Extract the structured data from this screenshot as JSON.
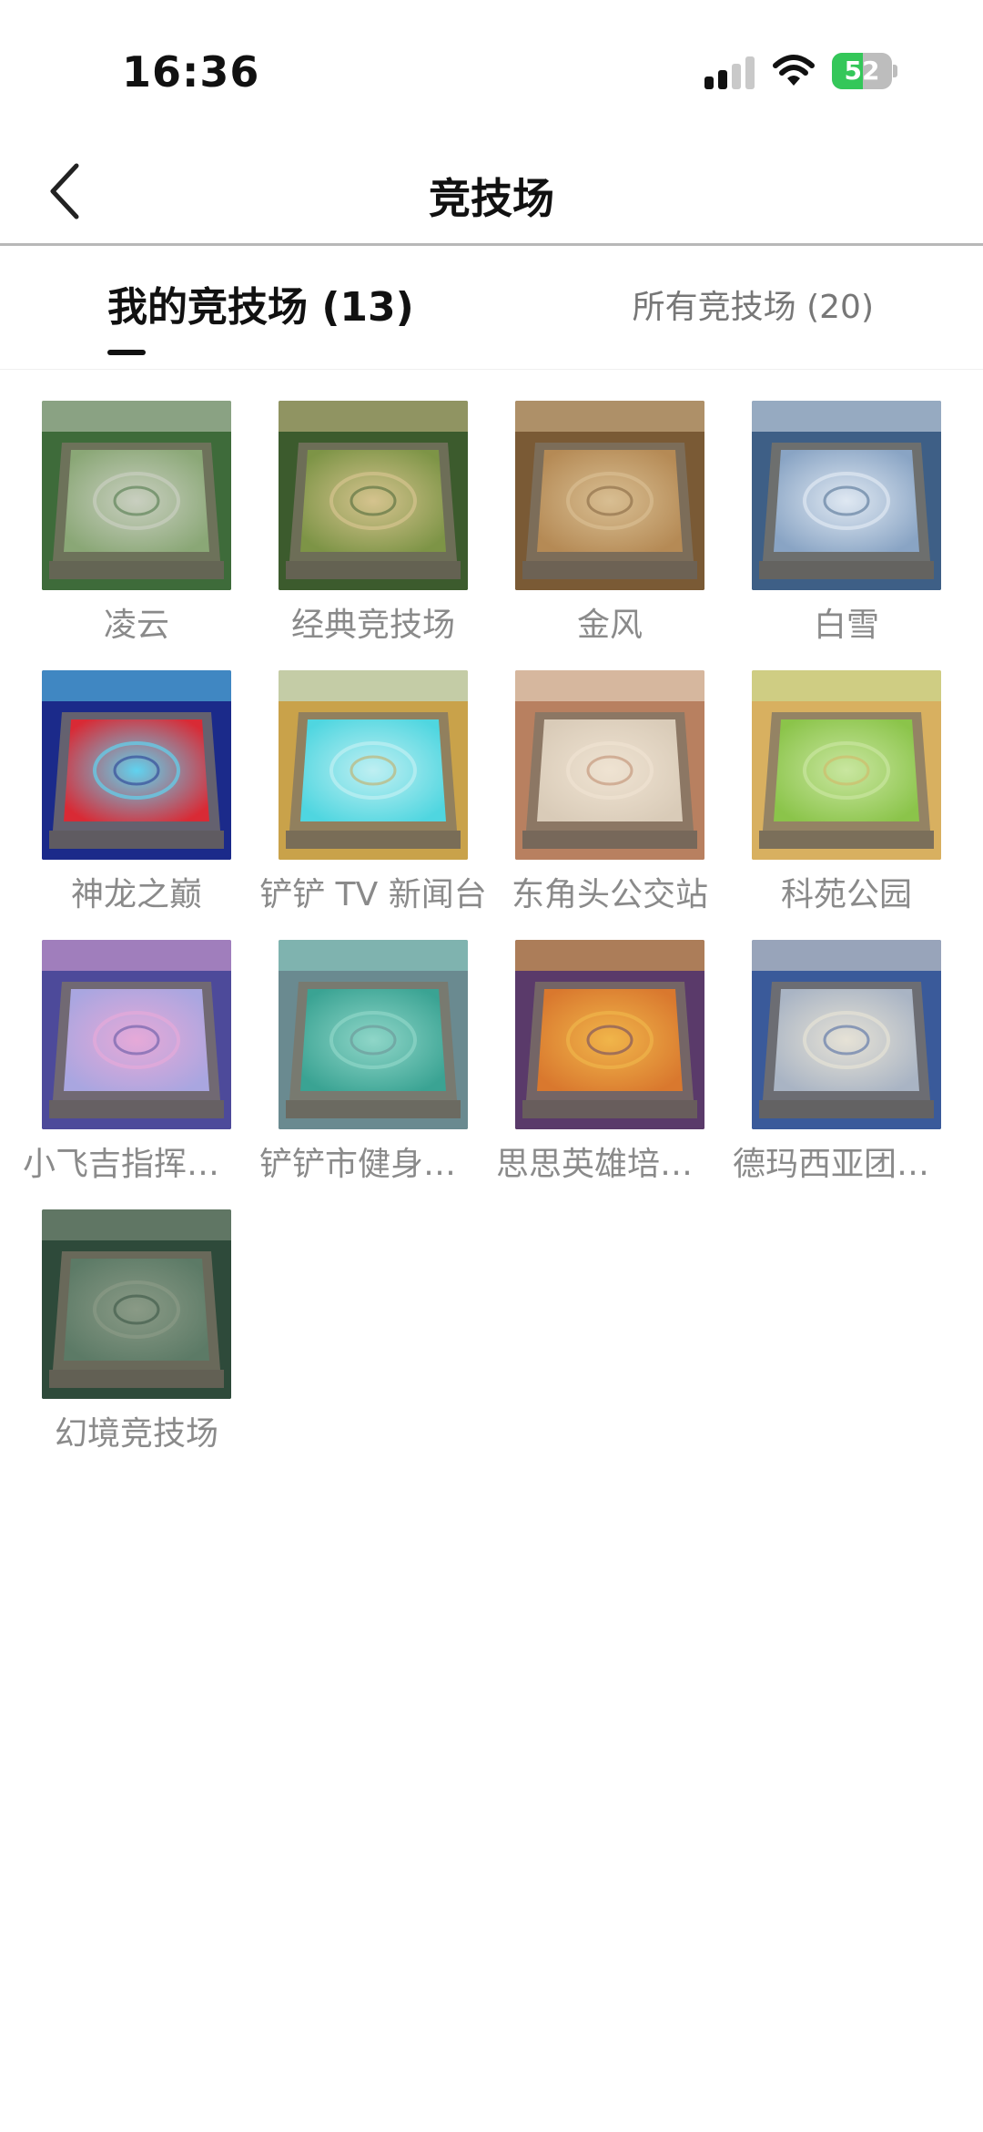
{
  "status_bar": {
    "time": "16:36",
    "battery_level": "52",
    "battery_fraction": 0.52,
    "icons": [
      "signal-icon",
      "wifi-icon",
      "battery-charging-icon"
    ]
  },
  "nav": {
    "title": "竞技场",
    "back_icon": "chevron-left-icon"
  },
  "tabs": [
    {
      "label": "我的竞技场 (13)",
      "active": true
    },
    {
      "label": "所有竞技场 (20)",
      "active": false
    }
  ],
  "arenas": [
    {
      "name": "凌云",
      "palette": [
        "#3e6b3a",
        "#8aa776",
        "#c9cfc0"
      ]
    },
    {
      "name": "经典竞技场",
      "palette": [
        "#3c5b2d",
        "#7d9446",
        "#d5c38e"
      ]
    },
    {
      "name": "金风",
      "palette": [
        "#7a5a35",
        "#b58a55",
        "#d8be92"
      ]
    },
    {
      "name": "白雪",
      "palette": [
        "#3e5f86",
        "#89a4c4",
        "#dfe8f2"
      ]
    },
    {
      "name": "神龙之巅",
      "palette": [
        "#1b2a8a",
        "#d92a35",
        "#5fd3f0"
      ]
    },
    {
      "name": "铲铲 TV 新闻台",
      "palette": [
        "#c9a24a",
        "#4fd6e0",
        "#bfeff2"
      ]
    },
    {
      "name": "东角头公交站",
      "palette": [
        "#b88060",
        "#d9cbb8",
        "#efe3d2"
      ]
    },
    {
      "name": "科苑公园",
      "palette": [
        "#d8b060",
        "#8bc44a",
        "#c9e6a0"
      ]
    },
    {
      "name": "小飞吉指挥中心",
      "palette": [
        "#4d4a9a",
        "#a9a6e0",
        "#e6a9d8"
      ]
    },
    {
      "name": "铲铲市健身中心",
      "palette": [
        "#6a8a90",
        "#3aa393",
        "#8fd6c8"
      ]
    },
    {
      "name": "思思英雄培训营",
      "palette": [
        "#5a3a6a",
        "#d9782e",
        "#f0b54a"
      ]
    },
    {
      "name": "德玛西亚团结广场",
      "palette": [
        "#3a5a9a",
        "#a9b4c4",
        "#e6e2d6"
      ]
    },
    {
      "name": "幻境竞技场",
      "palette": [
        "#2e4a3a",
        "#5c7a66",
        "#8a9a86"
      ]
    }
  ]
}
